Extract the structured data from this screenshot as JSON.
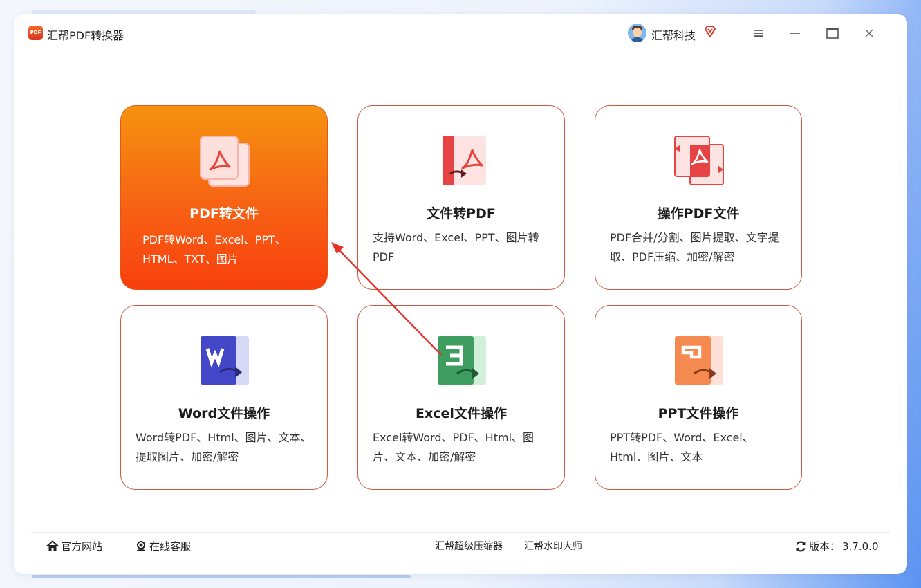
{
  "app": {
    "logo_text": "PDF",
    "title": "汇帮PDF转换器"
  },
  "user": {
    "name": "汇帮科技",
    "avatar_icon": "avatar",
    "vip_icon": "diamond-icon"
  },
  "window_controls": [
    "menu-icon",
    "minimize-icon",
    "maximize-icon",
    "close-icon"
  ],
  "cards": [
    {
      "id": "pdf-to-file",
      "title": "PDF转文件",
      "desc": "PDF转Word、Excel、PPT、HTML、TXT、图片",
      "active": true
    },
    {
      "id": "file-to-pdf",
      "title": "文件转PDF",
      "desc": "支持Word、Excel、PPT、图片转PDF",
      "active": false
    },
    {
      "id": "pdf-operate",
      "title": "操作PDF文件",
      "desc": "PDF合并/分割、图片提取、文字提取、PDF压缩、加密/解密",
      "active": false
    },
    {
      "id": "word-operate",
      "title": "Word文件操作",
      "desc": "Word转PDF、Html、图片、文本、提取图片、加密/解密",
      "active": false
    },
    {
      "id": "excel-operate",
      "title": "Excel文件操作",
      "desc": "Excel转Word、PDF、Html、图片、文本、加密/解密",
      "active": false
    },
    {
      "id": "ppt-operate",
      "title": "PPT文件操作",
      "desc": "PPT转PDF、Word、Excel、Html、图片、文本",
      "active": false
    }
  ],
  "statusbar": {
    "official_site": "官方网站",
    "online_service": "在线客服",
    "compressor": "汇帮超级压缩器",
    "watermark": "汇帮水印大师",
    "version_label": "版本：",
    "version_value": "3.7.0.0"
  },
  "colors": {
    "accent_orange": "#f76214",
    "card_border": "#c95a46",
    "word_blue": "#4446c8",
    "excel_green": "#3f9d5f",
    "ppt_orange": "#f48a4f",
    "annotation_red": "#e5332a"
  }
}
